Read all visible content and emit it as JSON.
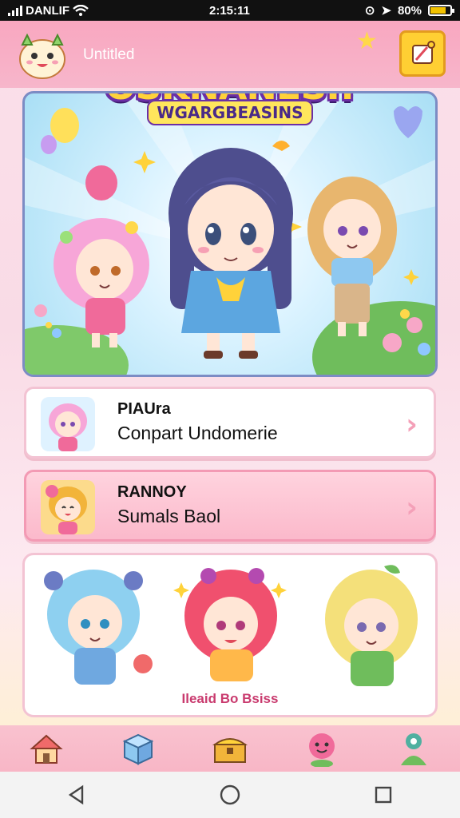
{
  "status_bar": {
    "carrier": "DANLIF",
    "time": "2:15:11",
    "battery": "80%",
    "battery_level": 0.8
  },
  "header": {
    "username": "Untitled",
    "menu_icon": "scroll-icon"
  },
  "banner": {
    "title": "OSKNANESI!",
    "subtitle": "WGARGBEASINS"
  },
  "list": [
    {
      "title": "PIAUra",
      "subtitle": "Conpart Undomerie",
      "icon": "chevron-right-icon"
    },
    {
      "title": "RANNOY",
      "subtitle": "Sumals Baol",
      "icon": "chevron-right-icon"
    }
  ],
  "gallery": {
    "caption": "Ileaid Bo Bsiss"
  },
  "bottom_nav": [
    {
      "name": "home",
      "icon": "house-icon"
    },
    {
      "name": "box",
      "icon": "gift-box-icon"
    },
    {
      "name": "shop",
      "icon": "treasure-chest-icon"
    },
    {
      "name": "friend",
      "icon": "smiley-icon"
    },
    {
      "name": "profile",
      "icon": "person-icon"
    }
  ],
  "system_nav": [
    "back-icon",
    "home-circle-icon",
    "recents-icon"
  ],
  "colors": {
    "header": "#f9a7c0",
    "accent_pink": "#f4a0b8",
    "accent_yellow": "#ffcf33",
    "title_purple": "#6b2fa6"
  }
}
